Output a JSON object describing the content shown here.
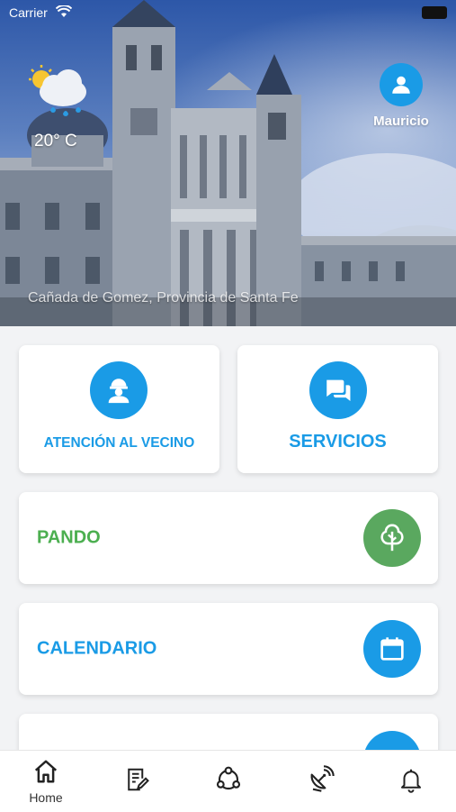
{
  "status_bar": {
    "carrier": "Carrier"
  },
  "weather": {
    "temperature": "20° C",
    "icon": "cloud-sun-rain-icon"
  },
  "user": {
    "name": "Mauricio",
    "icon": "user-icon"
  },
  "location": "Cañada de Gomez, Provincia de Santa Fe",
  "tiles": [
    {
      "label": "ATENCIÓN AL VECINO",
      "icon": "worker-icon"
    },
    {
      "label": "SERVICIOS",
      "icon": "chat-icon"
    }
  ],
  "rows": [
    {
      "label": "PANDO",
      "icon": "tree-icon",
      "color": "#4caf50",
      "icon_color": "#5aa85f"
    },
    {
      "label": "CALENDARIO",
      "icon": "calendar-icon",
      "color": "#1a9be6",
      "icon_color": "#1a9be6"
    }
  ],
  "tabbar": {
    "home_label": "Home",
    "icons": [
      "home-icon",
      "document-edit-icon",
      "share-icon",
      "satellite-dish-icon",
      "bell-icon"
    ]
  },
  "colors": {
    "accent": "#1a9be6",
    "green": "#4caf50",
    "background": "#f2f3f5"
  }
}
